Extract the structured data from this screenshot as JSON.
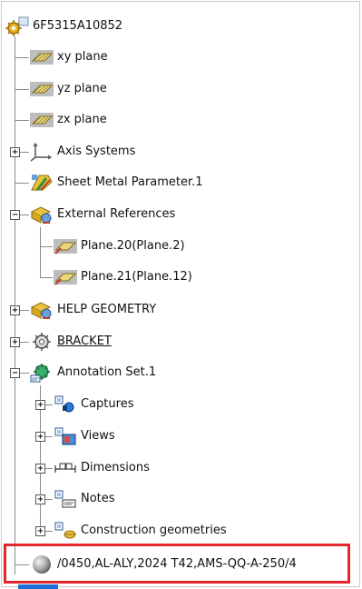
{
  "tree": {
    "root": {
      "label": "6F5315A10852",
      "icon": "part-gear-icon"
    },
    "planes": [
      {
        "label": "xy plane",
        "icon": "plane-icon"
      },
      {
        "label": "yz plane",
        "icon": "plane-icon"
      },
      {
        "label": "zx plane",
        "icon": "plane-icon"
      }
    ],
    "axis_systems": {
      "label": "Axis Systems",
      "icon": "axis-system-icon"
    },
    "sheet_metal": {
      "label": "Sheet Metal Parameter.1",
      "icon": "sheet-metal-icon"
    },
    "external_references": {
      "label": "External References",
      "icon": "external-references-icon",
      "children": [
        {
          "label": "Plane.20(Plane.2)",
          "icon": "plane-icon"
        },
        {
          "label": "Plane.21(Plane.12)",
          "icon": "plane-icon"
        }
      ]
    },
    "help_geometry": {
      "label": "HELP GEOMETRY",
      "icon": "geometry-set-icon"
    },
    "bracket": {
      "label": "BRACKET",
      "icon": "body-icon"
    },
    "annotation_set": {
      "label": "Annotation Set.1",
      "icon": "annotation-set-icon",
      "children": [
        {
          "label": "Captures",
          "icon": "captures-icon"
        },
        {
          "label": "Views",
          "icon": "views-icon"
        },
        {
          "label": "Dimensions",
          "icon": "dimensions-icon"
        },
        {
          "label": "Notes",
          "icon": "notes-icon"
        },
        {
          "label": "Construction geometries",
          "icon": "construction-geometries-icon"
        }
      ]
    },
    "material": {
      "label": "/0450,AL-ALY,2024 T42,AMS-QQ-A-250/4",
      "icon": "material-sphere-icon"
    }
  },
  "colors": {
    "selection_border": "#e3262f",
    "tree_lines": "#8a8a8a"
  }
}
